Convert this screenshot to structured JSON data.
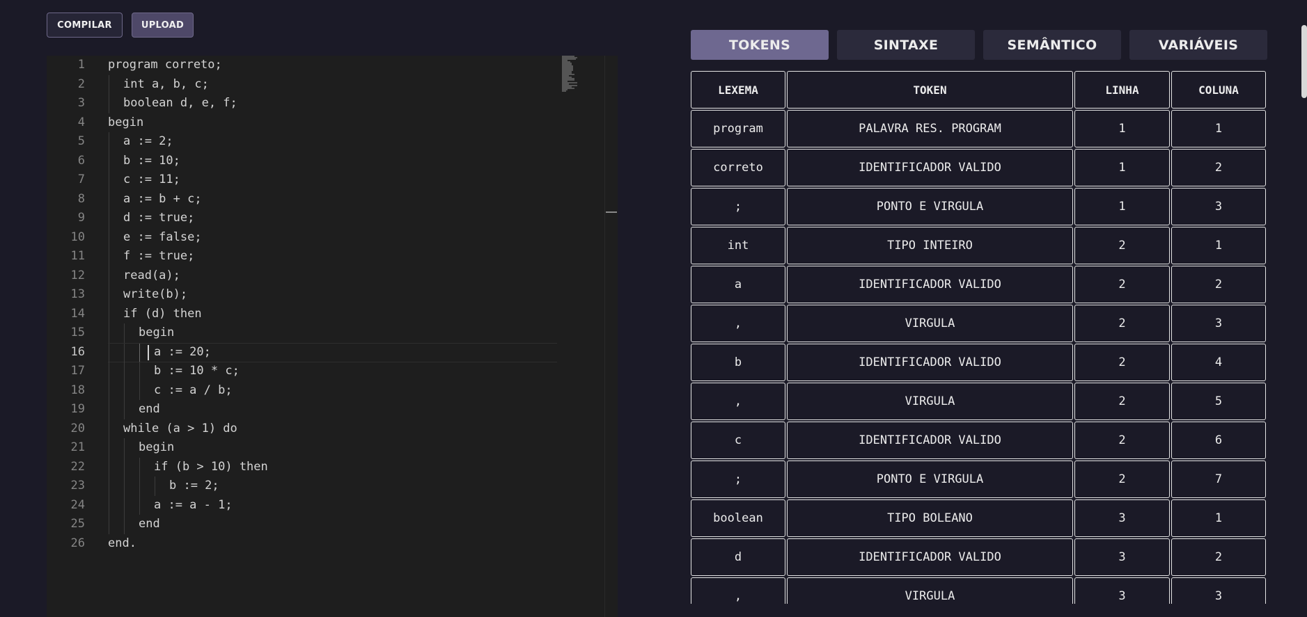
{
  "toolbar": {
    "compile_label": "COMPILAR",
    "upload_label": "UPLOAD"
  },
  "editor": {
    "current_line": 16,
    "lines": [
      {
        "n": "1",
        "indent": 0,
        "text": "program correto;"
      },
      {
        "n": "2",
        "indent": 1,
        "text": "int a, b, c;"
      },
      {
        "n": "3",
        "indent": 1,
        "text": "boolean d, e, f;"
      },
      {
        "n": "4",
        "indent": 0,
        "text": "begin"
      },
      {
        "n": "5",
        "indent": 1,
        "text": "a := 2;"
      },
      {
        "n": "6",
        "indent": 1,
        "text": "b := 10;"
      },
      {
        "n": "7",
        "indent": 1,
        "text": "c := 11;"
      },
      {
        "n": "8",
        "indent": 1,
        "text": "a := b + c;"
      },
      {
        "n": "9",
        "indent": 1,
        "text": "d := true;"
      },
      {
        "n": "10",
        "indent": 1,
        "text": "e := false;"
      },
      {
        "n": "11",
        "indent": 1,
        "text": "f := true;"
      },
      {
        "n": "12",
        "indent": 1,
        "text": "read(a);"
      },
      {
        "n": "13",
        "indent": 1,
        "text": "write(b);"
      },
      {
        "n": "14",
        "indent": 1,
        "text": "if (d) then"
      },
      {
        "n": "15",
        "indent": 2,
        "text": "begin"
      },
      {
        "n": "16",
        "indent": 3,
        "text": "a := 20;"
      },
      {
        "n": "17",
        "indent": 3,
        "text": "b := 10 * c;"
      },
      {
        "n": "18",
        "indent": 3,
        "text": "c := a / b;"
      },
      {
        "n": "19",
        "indent": 2,
        "text": "end"
      },
      {
        "n": "20",
        "indent": 1,
        "text": "while (a > 1) do"
      },
      {
        "n": "21",
        "indent": 2,
        "text": "begin"
      },
      {
        "n": "22",
        "indent": 3,
        "text": "if (b > 10) then"
      },
      {
        "n": "23",
        "indent": 4,
        "text": "b := 2;"
      },
      {
        "n": "24",
        "indent": 3,
        "text": "a := a - 1;"
      },
      {
        "n": "25",
        "indent": 2,
        "text": "end"
      },
      {
        "n": "26",
        "indent": 0,
        "text": "end."
      }
    ]
  },
  "tabs": [
    {
      "label": "TOKENS",
      "active": true
    },
    {
      "label": "SINTAXE",
      "active": false
    },
    {
      "label": "SEMÂNTICO",
      "active": false
    },
    {
      "label": "VARIÁVEIS",
      "active": false
    }
  ],
  "tokens_table": {
    "headers": [
      "LEXEMA",
      "TOKEN",
      "LINHA",
      "COLUNA"
    ],
    "rows": [
      [
        "program",
        "PALAVRA RES. PROGRAM",
        "1",
        "1"
      ],
      [
        "correto",
        "IDENTIFICADOR VALIDO",
        "1",
        "2"
      ],
      [
        ";",
        "PONTO E VIRGULA",
        "1",
        "3"
      ],
      [
        "int",
        "TIPO INTEIRO",
        "2",
        "1"
      ],
      [
        "a",
        "IDENTIFICADOR VALIDO",
        "2",
        "2"
      ],
      [
        ",",
        "VIRGULA",
        "2",
        "3"
      ],
      [
        "b",
        "IDENTIFICADOR VALIDO",
        "2",
        "4"
      ],
      [
        ",",
        "VIRGULA",
        "2",
        "5"
      ],
      [
        "c",
        "IDENTIFICADOR VALIDO",
        "2",
        "6"
      ],
      [
        ";",
        "PONTO E VIRGULA",
        "2",
        "7"
      ],
      [
        "boolean",
        "TIPO BOLEANO",
        "3",
        "1"
      ],
      [
        "d",
        "IDENTIFICADOR VALIDO",
        "3",
        "2"
      ],
      [
        ",",
        "VIRGULA",
        "3",
        "3"
      ]
    ]
  }
}
